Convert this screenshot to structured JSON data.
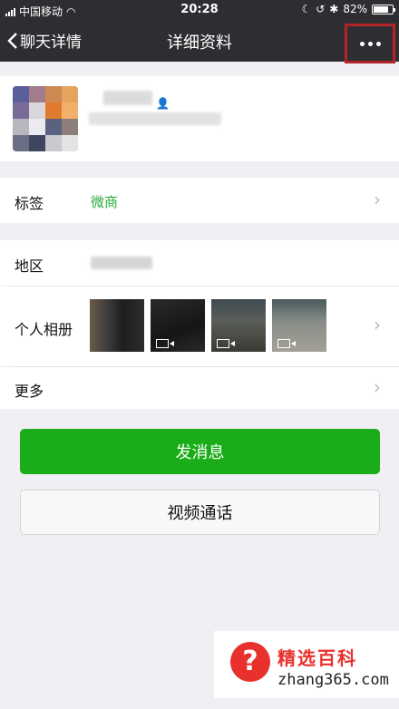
{
  "status": {
    "carrier": "中国移动",
    "time": "20:28",
    "battery": "82%",
    "battery_level": 0.82
  },
  "nav": {
    "back_label": "聊天详情",
    "title": "详细资料",
    "more_icon": "more-dots-icon"
  },
  "rows": {
    "tag_label": "标签",
    "tag_value": "微商",
    "region_label": "地区",
    "album_label": "个人相册",
    "more_label": "更多"
  },
  "buttons": {
    "send_message": "发消息",
    "video_call": "视频通话"
  },
  "watermark": {
    "title": "精选百科",
    "url": "zhang365.com",
    "icon": "?"
  },
  "colors": {
    "nav_bg": "#2e2e32",
    "accent_green": "#1aad19",
    "tag_green": "#2aab3a",
    "highlight_red": "#b3242a"
  }
}
